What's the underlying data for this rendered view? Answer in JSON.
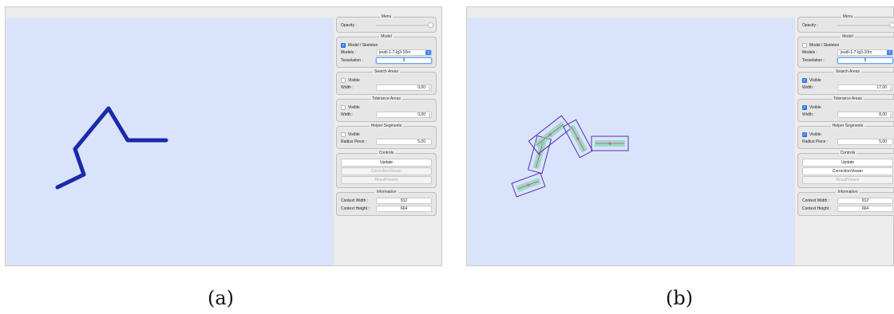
{
  "panels": [
    {
      "id": "a",
      "caption": "(a)",
      "menu": {
        "title": "Menu",
        "opacity_label": "Opacity :"
      },
      "model": {
        "title": "Model",
        "checkbox_label": "Model / Skeleton",
        "checkbox_checked": true,
        "models_label": "Models :",
        "models_value": "jeudi-1-7-lg3-10m",
        "tess_label": "Tesselation :",
        "tess_value": "0"
      },
      "search": {
        "title": "Search Areas",
        "visible_label": "Visible",
        "visible_checked": false,
        "width_label": "Width :",
        "width_value": "0,00"
      },
      "tolerance": {
        "title": "Tolerance Areas",
        "visible_label": "Visible",
        "visible_checked": false,
        "width_label": "Width :",
        "width_value": "0,00"
      },
      "helper": {
        "title": "Helper Segments",
        "visible_label": "Visible",
        "visible_checked": false,
        "radius_label": "Radius Piece :",
        "radius_value": "5,00"
      },
      "controls": {
        "title": "Controls",
        "update": "Update",
        "correction": "CorrectionViewer",
        "result": "ResultViewer"
      },
      "info": {
        "title": "Information",
        "cw_label": "Context Width :",
        "cw_value": "912",
        "ch_label": "Context Height :",
        "ch_value": "664"
      }
    },
    {
      "id": "b",
      "caption": "(b)",
      "menu": {
        "title": "Menu",
        "opacity_label": "Opacity :"
      },
      "model": {
        "title": "Model",
        "checkbox_label": "Model / Skeleton",
        "checkbox_checked": false,
        "models_label": "Models :",
        "models_value": "jeudi-1-7-lg3-10m",
        "tess_label": "Tesselation :",
        "tess_value": "5"
      },
      "search": {
        "title": "Search Areas",
        "visible_label": "Visible",
        "visible_checked": true,
        "width_label": "Width :",
        "width_value": "17,00"
      },
      "tolerance": {
        "title": "Tolerance Areas",
        "visible_label": "Visible",
        "visible_checked": true,
        "width_label": "Width :",
        "width_value": "8,00"
      },
      "helper": {
        "title": "Helper Segments",
        "visible_label": "Visible",
        "visible_checked": true,
        "radius_label": "Radius Piece :",
        "radius_value": "5,00"
      },
      "controls": {
        "title": "Controls",
        "update": "Update",
        "correction": "CorrectionViewer",
        "result": "ResultViewer"
      },
      "info": {
        "title": "Information",
        "cw_label": "Context Width :",
        "cw_value": "912",
        "ch_label": "Context Height :",
        "ch_value": "664"
      }
    }
  ],
  "colors": {
    "canvas_bg": "#d9e4fa",
    "skeleton_stroke": "#1a2aa8",
    "search_area": "#5a2bbf",
    "tolerance_area": "#7fd6b4",
    "helper_segment": "#e0407a",
    "checkbox_on": "#3a82f7"
  }
}
